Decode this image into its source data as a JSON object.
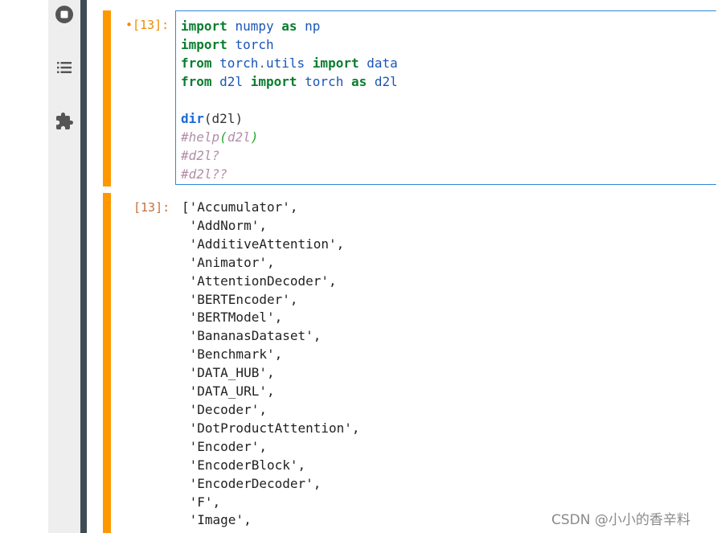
{
  "sidebar": {
    "icons": [
      "stop-icon",
      "list-icon",
      "puzzle-icon"
    ]
  },
  "input_cell": {
    "prompt": "•[13]:",
    "lines": [
      [
        {
          "t": "import",
          "c": "kw"
        },
        {
          "t": " ",
          "c": "pl"
        },
        {
          "t": "numpy",
          "c": "nm"
        },
        {
          "t": " ",
          "c": "pl"
        },
        {
          "t": "as",
          "c": "kw"
        },
        {
          "t": " ",
          "c": "pl"
        },
        {
          "t": "np",
          "c": "nm"
        }
      ],
      [
        {
          "t": "import",
          "c": "kw"
        },
        {
          "t": " ",
          "c": "pl"
        },
        {
          "t": "torch",
          "c": "nm"
        }
      ],
      [
        {
          "t": "from",
          "c": "kw"
        },
        {
          "t": " ",
          "c": "pl"
        },
        {
          "t": "torch",
          "c": "nm"
        },
        {
          "t": ".",
          "c": "op"
        },
        {
          "t": "utils",
          "c": "nm"
        },
        {
          "t": " ",
          "c": "pl"
        },
        {
          "t": "import",
          "c": "kw"
        },
        {
          "t": " ",
          "c": "pl"
        },
        {
          "t": "data",
          "c": "nm"
        }
      ],
      [
        {
          "t": "from",
          "c": "kw"
        },
        {
          "t": " ",
          "c": "pl"
        },
        {
          "t": "d2l",
          "c": "nm"
        },
        {
          "t": " ",
          "c": "pl"
        },
        {
          "t": "import",
          "c": "kw"
        },
        {
          "t": " ",
          "c": "pl"
        },
        {
          "t": "torch",
          "c": "nm"
        },
        {
          "t": " ",
          "c": "pl"
        },
        {
          "t": "as",
          "c": "kw"
        },
        {
          "t": " ",
          "c": "pl"
        },
        {
          "t": "d2l",
          "c": "nm"
        }
      ],
      [],
      [
        {
          "t": "dir",
          "c": "bi"
        },
        {
          "t": "(",
          "c": "pl"
        },
        {
          "t": "d2l",
          "c": "pl"
        },
        {
          "t": ")",
          "c": "pl"
        }
      ],
      [
        {
          "t": "#help",
          "c": "cm"
        },
        {
          "t": "(",
          "c": "cm-paren"
        },
        {
          "t": "d2l",
          "c": "cm"
        },
        {
          "t": ")",
          "c": "cm-paren"
        }
      ],
      [
        {
          "t": "#d2l?",
          "c": "cm"
        }
      ],
      [
        {
          "t": "#d2l??",
          "c": "cm"
        }
      ]
    ]
  },
  "output_cell": {
    "prompt": "[13]:",
    "lines": [
      "['Accumulator',",
      " 'AddNorm',",
      " 'AdditiveAttention',",
      " 'Animator',",
      " 'AttentionDecoder',",
      " 'BERTEncoder',",
      " 'BERTModel',",
      " 'BananasDataset',",
      " 'Benchmark',",
      " 'DATA_HUB',",
      " 'DATA_URL',",
      " 'Decoder',",
      " 'DotProductAttention',",
      " 'Encoder',",
      " 'EncoderBlock',",
      " 'EncoderDecoder',",
      " 'F',",
      " 'Image',"
    ]
  },
  "watermark": "CSDN @小小的香辛料"
}
